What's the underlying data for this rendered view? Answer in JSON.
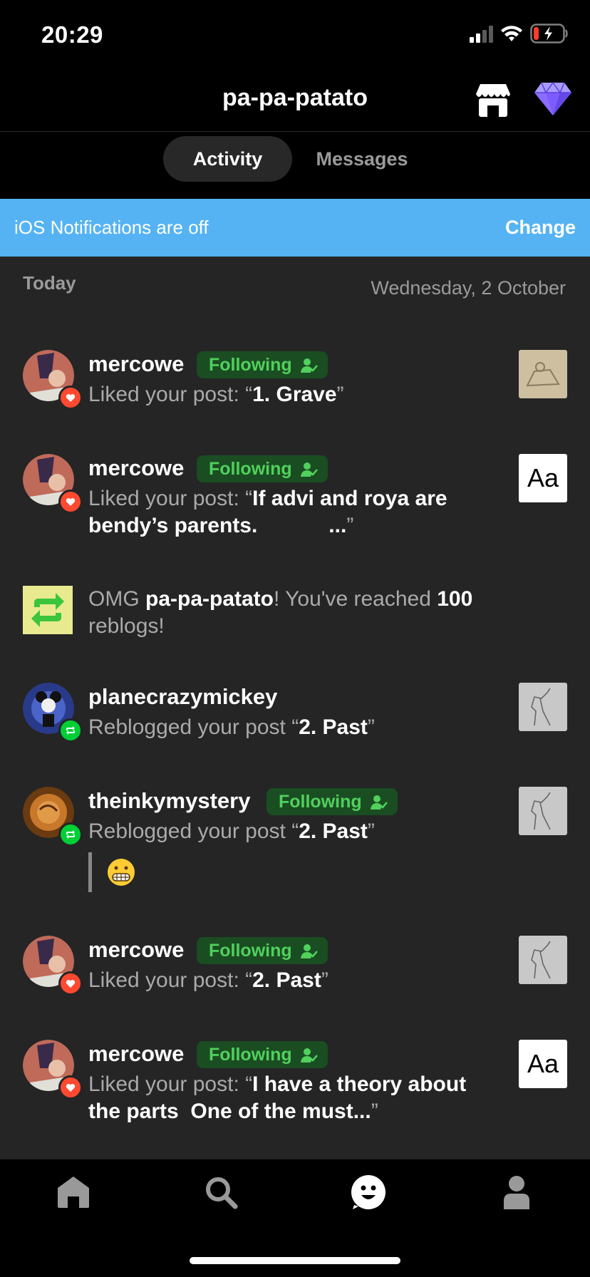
{
  "status": {
    "time": "20:29"
  },
  "header": {
    "title": "pa-pa-patato",
    "icons": [
      "shop-icon",
      "diamond-icon"
    ]
  },
  "tabs": {
    "activity": "Activity",
    "messages": "Messages"
  },
  "banner": {
    "text": "iOS Notifications are off",
    "action": "Change"
  },
  "section": {
    "today": "Today",
    "date": "Wednesday, 2 October"
  },
  "following_label": "Following",
  "items": [
    {
      "name": "mercowe",
      "action": "Liked your post: “",
      "post": "1. Grave",
      "end": "”"
    },
    {
      "name": "mercowe",
      "action": "Liked your post: “",
      "post": "If advi and roya are bendy’s parents.            ...",
      "end": "”",
      "thumb_text": "Aa"
    },
    {
      "milestone": {
        "pre": "OMG ",
        "blog": "pa-pa-patato",
        "mid": "! You've reached ",
        "count": "100",
        "post": " reblogs!"
      }
    },
    {
      "name": "planecrazymickey",
      "action": "Reblogged your post “",
      "post": "2. Past",
      "end": "”"
    },
    {
      "name": "theinkymystery",
      "action": "Reblogged your post “",
      "post": "2. Past",
      "end": "”",
      "quote_emoji": "grimacing-emoji"
    },
    {
      "name": "mercowe",
      "action": "Liked your post: “",
      "post": "2. Past",
      "end": "”"
    },
    {
      "name": "mercowe",
      "action": "Liked your post: “",
      "post": "I have a theory about the parts  One of the must...",
      "end": "”",
      "thumb_text": "Aa"
    }
  ],
  "navbar": {
    "icons": [
      "home-icon",
      "search-icon",
      "activity-icon",
      "account-icon"
    ]
  },
  "colors": {
    "banner": "#55b3f3",
    "following_bg": "#1a4d22",
    "following_text": "#50d05c",
    "like": "#ff4930",
    "reblog": "#00cf35"
  }
}
